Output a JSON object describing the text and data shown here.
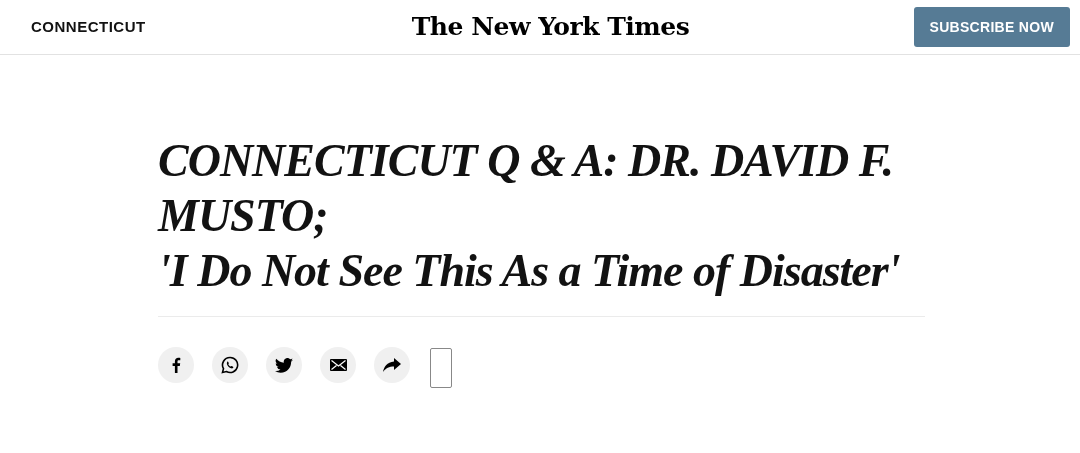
{
  "header": {
    "section": "CONNECTICUT",
    "logo": "The New York Times",
    "subscribe_button": "SUBSCRIBE NOW"
  },
  "headline": [
    "CONNECTICUT Q & A: DR. DAVID F. MUSTO;",
    "'I Do Not See This As a Time of Disaster'"
  ],
  "share_tools": [
    {
      "kind": "facebook"
    },
    {
      "kind": "whatsapp"
    },
    {
      "kind": "twitter"
    },
    {
      "kind": "email"
    },
    {
      "kind": "share"
    },
    {
      "kind": "bookmark"
    }
  ]
}
